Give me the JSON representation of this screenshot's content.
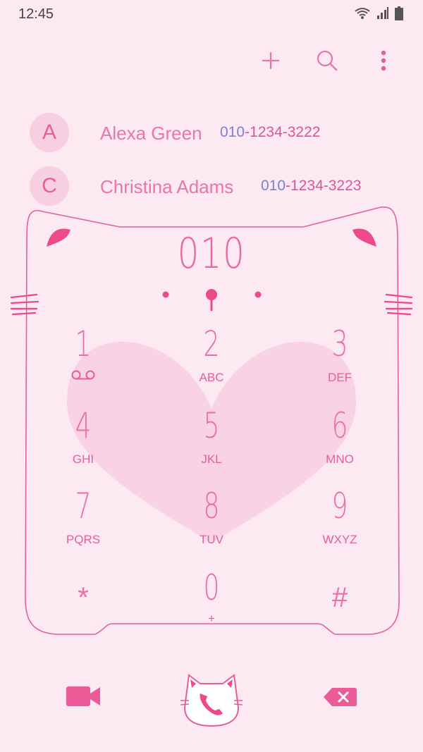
{
  "status_bar": {
    "time": "12:45",
    "icons": [
      "wifi-icon",
      "cellular-signal-icon",
      "battery-icon"
    ]
  },
  "toolbar": {
    "actions": [
      "add-icon",
      "search-icon",
      "more-vertical-icon"
    ]
  },
  "contacts": [
    {
      "initial": "A",
      "name": "Alexa Green",
      "number_prefix": "010",
      "number_rest": "-1234-3222"
    },
    {
      "initial": "C",
      "name": "Christina Adams",
      "number_prefix": "010",
      "number_rest": "-1234-3223"
    }
  ],
  "dialer": {
    "entered_number": "010",
    "keys": [
      {
        "digit": "1",
        "letters": "",
        "icon": "voicemail-icon"
      },
      {
        "digit": "2",
        "letters": "ABC"
      },
      {
        "digit": "3",
        "letters": "DEF"
      },
      {
        "digit": "4",
        "letters": "GHI"
      },
      {
        "digit": "5",
        "letters": "JKL"
      },
      {
        "digit": "6",
        "letters": "MNO"
      },
      {
        "digit": "7",
        "letters": "PQRS"
      },
      {
        "digit": "8",
        "letters": "TUV"
      },
      {
        "digit": "9",
        "letters": "WXYZ"
      },
      {
        "digit": "*",
        "letters": ""
      },
      {
        "digit": "0",
        "letters": "+"
      },
      {
        "digit": "#",
        "letters": ""
      }
    ]
  },
  "bottom_actions": [
    "video-call-icon",
    "call-icon",
    "backspace-icon"
  ],
  "colors": {
    "background": "#fde9f1",
    "accent": "#e4609a",
    "heart": "#f9d2e3",
    "number_prefix": "#7b7fd6"
  }
}
